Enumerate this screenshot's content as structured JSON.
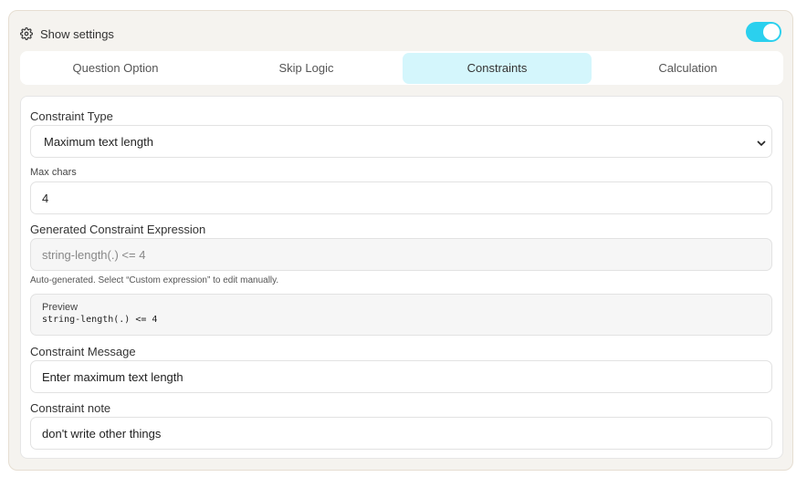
{
  "settings": {
    "label": "Show settings",
    "toggle_on": true,
    "toggle_color": "#2bd0ee"
  },
  "tabs": [
    {
      "label": "Question Option",
      "active": false
    },
    {
      "label": "Skip Logic",
      "active": false
    },
    {
      "label": "Constraints",
      "active": true
    },
    {
      "label": "Calculation",
      "active": false
    }
  ],
  "form": {
    "constraint_type": {
      "label": "Constraint Type",
      "value": "Maximum text length"
    },
    "max_chars": {
      "label": "Max chars",
      "value": "4"
    },
    "generated": {
      "label": "Generated Constraint Expression",
      "value": "string-length(.) <= 4",
      "hint": "Auto-generated. Select “Custom expression” to edit manually."
    },
    "preview": {
      "title": "Preview",
      "code": "string-length(.) <= 4"
    },
    "message": {
      "label": "Constraint Message",
      "value": "Enter maximum text length"
    },
    "note": {
      "label": "Constraint note",
      "value": "don't write other things"
    }
  }
}
